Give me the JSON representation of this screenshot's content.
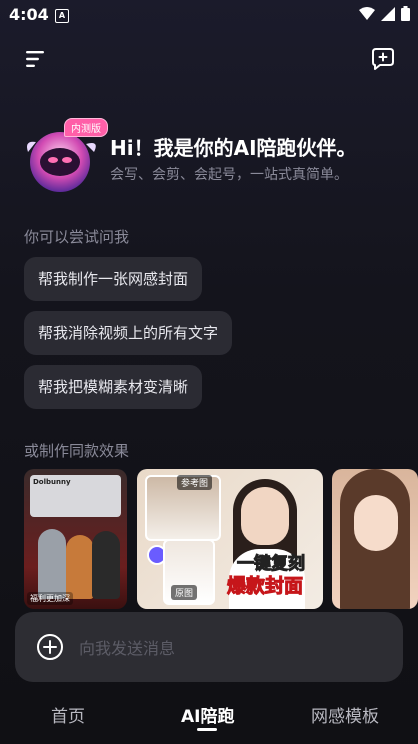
{
  "status_bar": {
    "time": "4:04",
    "notification_icon": "a-letter-icon",
    "icons": [
      "wifi-icon",
      "signal-icon",
      "battery-icon"
    ]
  },
  "header": {
    "menu_icon": "menu-icon",
    "new_chat_icon": "new-chat-icon"
  },
  "hero": {
    "badge": "内测版",
    "title": "Hi！我是你的AI陪跑伙伴。",
    "subtitle": "会写、会剪、会起号，一站式真简单。"
  },
  "suggestions": {
    "label": "你可以尝试问我",
    "items": [
      "帮我制作一张网感封面",
      "帮我消除视频上的所有文字",
      "帮我把模糊素材变清晰"
    ]
  },
  "templates": {
    "label": "或制作同款效果",
    "card1": {
      "logo": "Dolbunny",
      "tag": "福利更加深"
    },
    "card2": {
      "ref_tag": "参考图",
      "ref_caption": "长期主义",
      "orig_tag": "原图",
      "line1": "一键复刻",
      "line2": "爆款封面"
    }
  },
  "composer": {
    "placeholder": "向我发送消息"
  },
  "tabs": {
    "home": "首页",
    "ai": "AI陪跑",
    "templates": "网感模板",
    "active": "ai"
  },
  "colors": {
    "accent_badge": "#ff5fa8",
    "chip_bg": "#2b2b33",
    "muted_text": "#8a8a99",
    "active_tab": "#ffffff"
  }
}
